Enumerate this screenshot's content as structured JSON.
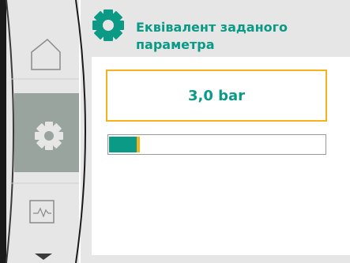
{
  "header": {
    "title": "Еквівалент заданого параметра",
    "icon": "gear-icon"
  },
  "value_display": {
    "text": "3,0 bar"
  },
  "progress": {
    "fill_fraction": 0.13
  },
  "sidebar": {
    "items": [
      {
        "icon": "home-icon",
        "active": false
      },
      {
        "icon": "settings-gear-icon",
        "active": true
      },
      {
        "icon": "diagnostics-icon",
        "active": false
      }
    ],
    "scroll_indicator": "chevron-down-icon"
  },
  "colors": {
    "accent": "#0b9a86",
    "highlight": "#f5b21c",
    "active_nav": "#9aa49e",
    "panel": "#e6e6e6"
  }
}
